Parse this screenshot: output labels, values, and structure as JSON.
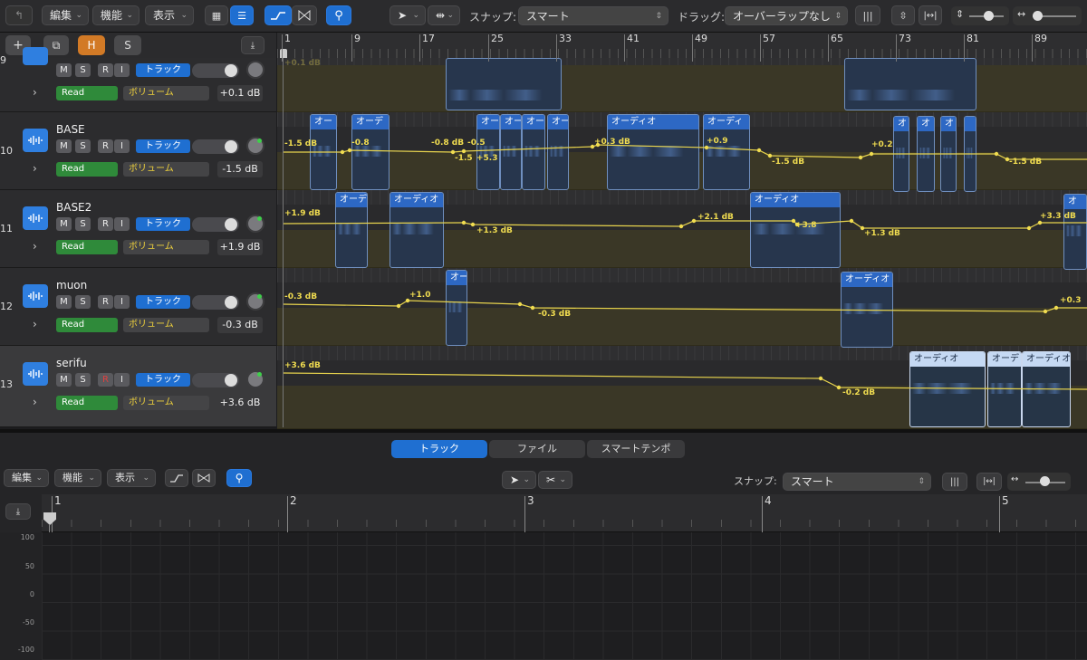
{
  "toolbar": {
    "edit": "編集",
    "function": "機能",
    "view": "表示",
    "snap_label": "スナップ:",
    "snap_value": "スマート",
    "drag_label": "ドラッグ:",
    "drag_value": "オーバーラップなし"
  },
  "track_header": {
    "add": "+",
    "dup": "⧉",
    "h": "H",
    "s": "S"
  },
  "ruler": [
    "1",
    "9",
    "17",
    "25",
    "33",
    "41",
    "49",
    "57",
    "65",
    "73",
    "81",
    "89"
  ],
  "tracks": [
    {
      "num": "9",
      "name": "",
      "mode": "Read",
      "param": "ボリューム",
      "db": "+0.1 dB",
      "m": "M",
      "s": "S",
      "r": "R",
      "i": "I",
      "track_btn": "トラック"
    },
    {
      "num": "10",
      "name": "BASE",
      "mode": "Read",
      "param": "ボリューム",
      "db": "-1.5 dB",
      "m": "M",
      "s": "S",
      "r": "R",
      "i": "I",
      "track_btn": "トラック"
    },
    {
      "num": "11",
      "name": "BASE2",
      "mode": "Read",
      "param": "ボリューム",
      "db": "+1.9 dB",
      "m": "M",
      "s": "S",
      "r": "R",
      "i": "I",
      "track_btn": "トラック"
    },
    {
      "num": "12",
      "name": "muon",
      "mode": "Read",
      "param": "ボリューム",
      "db": "-0.3 dB",
      "m": "M",
      "s": "S",
      "r": "R",
      "i": "I",
      "track_btn": "トラック"
    },
    {
      "num": "13",
      "name": "serifu",
      "mode": "Read",
      "param": "ボリューム",
      "db": "+3.6 dB",
      "m": "M",
      "s": "S",
      "r": "R",
      "i": "I",
      "track_btn": "トラック"
    }
  ],
  "regions": {
    "t10": [
      "オー",
      "オーデ",
      "オー",
      "オー",
      "オー",
      "オー",
      "オーディオ",
      "オーディ",
      "オ",
      "オ",
      "オ",
      ""
    ],
    "t11": [
      "オーデ",
      "オーディオ",
      "オーディオ",
      "オ"
    ],
    "t12": [
      "オー",
      "オーディオ"
    ],
    "t13": [
      "オーディオ",
      "オーデ",
      "オーディオ"
    ]
  },
  "automation": {
    "t9": [
      "+0.1 dB"
    ],
    "t10": [
      "-1.5 dB",
      "-0.8",
      "-0.8 dB",
      "-0.5",
      "-1.5",
      "+5.3",
      "+0.3 dB",
      "+0.9",
      "-1.5 dB",
      "+0.2",
      "-1.5 dB"
    ],
    "t11": [
      "+1.9 dB",
      "+1.3 dB",
      "+2.1 dB",
      "+3.8",
      "+1.3 dB",
      "+3.3 dB"
    ],
    "t12": [
      "-0.3 dB",
      "+1.0",
      "-0.3 dB",
      "+0.3"
    ],
    "t13": [
      "+3.6 dB",
      "-0.2 dB"
    ]
  },
  "bottom_tabs": {
    "track": "トラック",
    "file": "ファイル",
    "smart_tempo": "スマートテンポ"
  },
  "editor": {
    "edit": "編集",
    "function": "機能",
    "view": "表示",
    "snap_label": "スナップ:",
    "snap_value": "スマート",
    "ruler": [
      "1",
      "2",
      "3",
      "4",
      "5"
    ],
    "yaxis": [
      "100",
      "50",
      "0",
      "-50",
      "-100"
    ]
  }
}
